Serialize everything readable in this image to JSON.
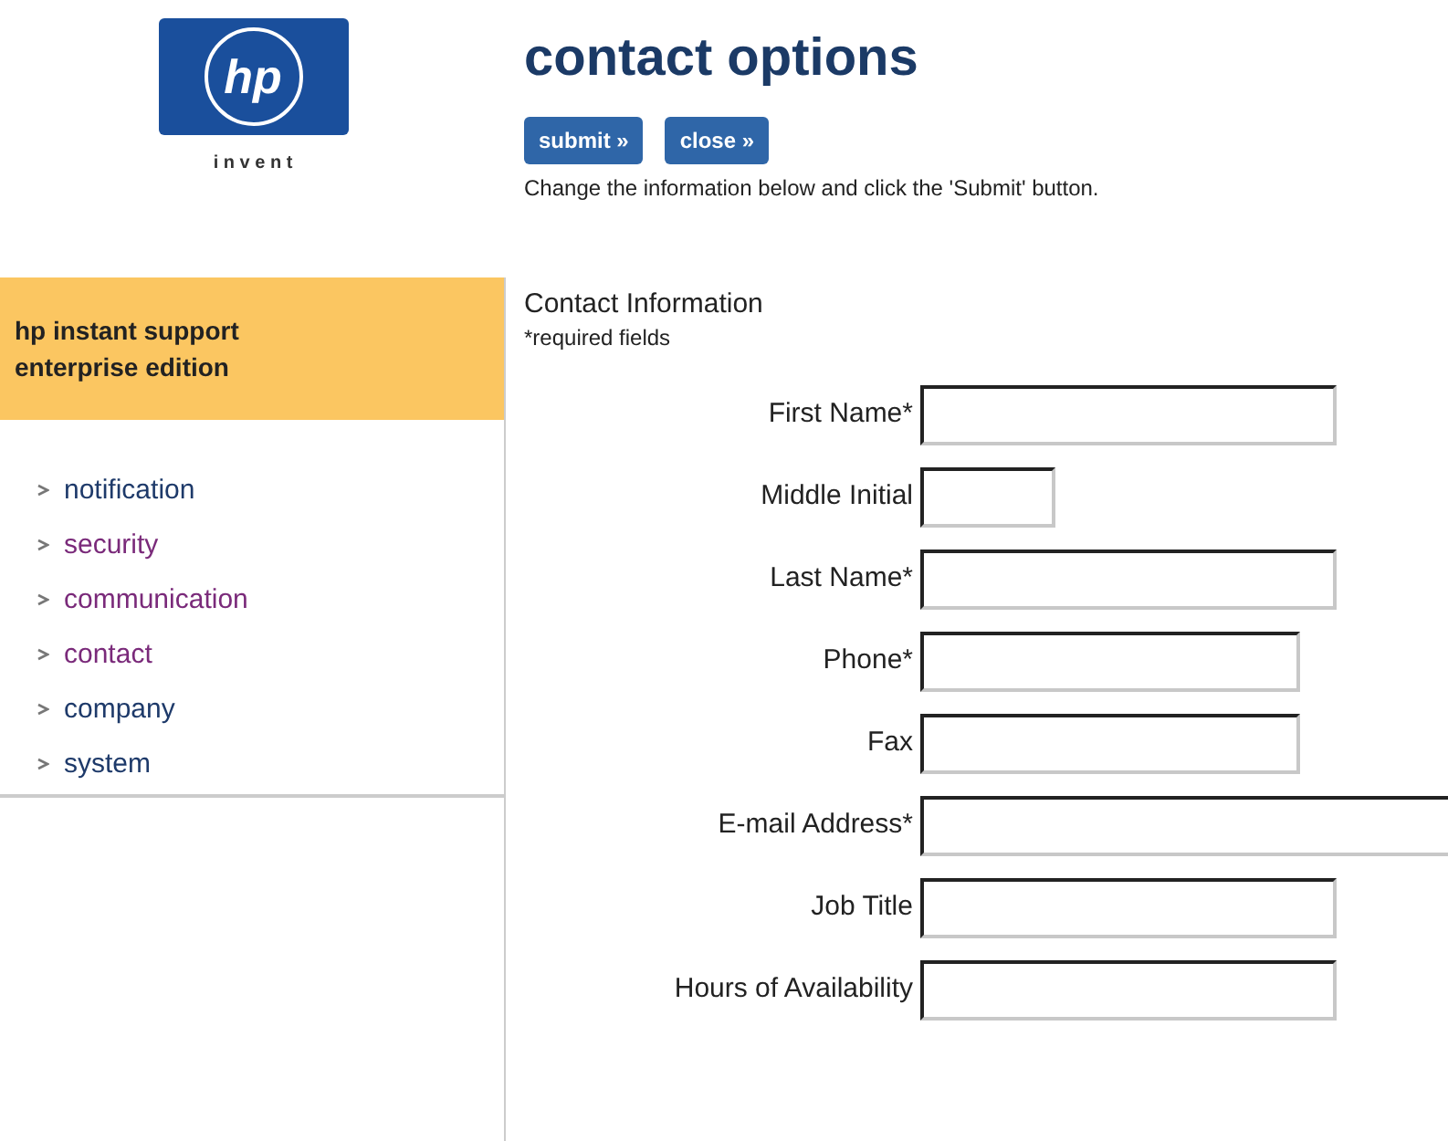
{
  "logo": {
    "mark": "hp",
    "tagline": "i n v e n t"
  },
  "product_box": {
    "title": "hp instant support enterprise edition"
  },
  "nav": [
    {
      "label": "notification",
      "visited": false
    },
    {
      "label": "security",
      "visited": true
    },
    {
      "label": "communication",
      "visited": true
    },
    {
      "label": "contact",
      "visited": true
    },
    {
      "label": "company",
      "visited": false
    },
    {
      "label": "system",
      "visited": false
    }
  ],
  "page_title": "contact options",
  "buttons": [
    "submit »",
    "close »"
  ],
  "instructions": "Change the information below and click the 'Submit' button.",
  "section": {
    "title": "Contact Information",
    "note": "*required fields"
  },
  "fields": [
    {
      "label": "First Name*",
      "kind": "long"
    },
    {
      "label": "Middle Initial",
      "kind": "short"
    },
    {
      "label": "Last Name*",
      "kind": "long"
    },
    {
      "label": "Phone*",
      "kind": "medium"
    },
    {
      "label": "Fax",
      "kind": "medium"
    },
    {
      "label": "E-mail Address*",
      "kind": "wide"
    },
    {
      "label": "Job Title",
      "kind": "long"
    },
    {
      "label": "Hours of Availability",
      "kind": "long"
    }
  ]
}
